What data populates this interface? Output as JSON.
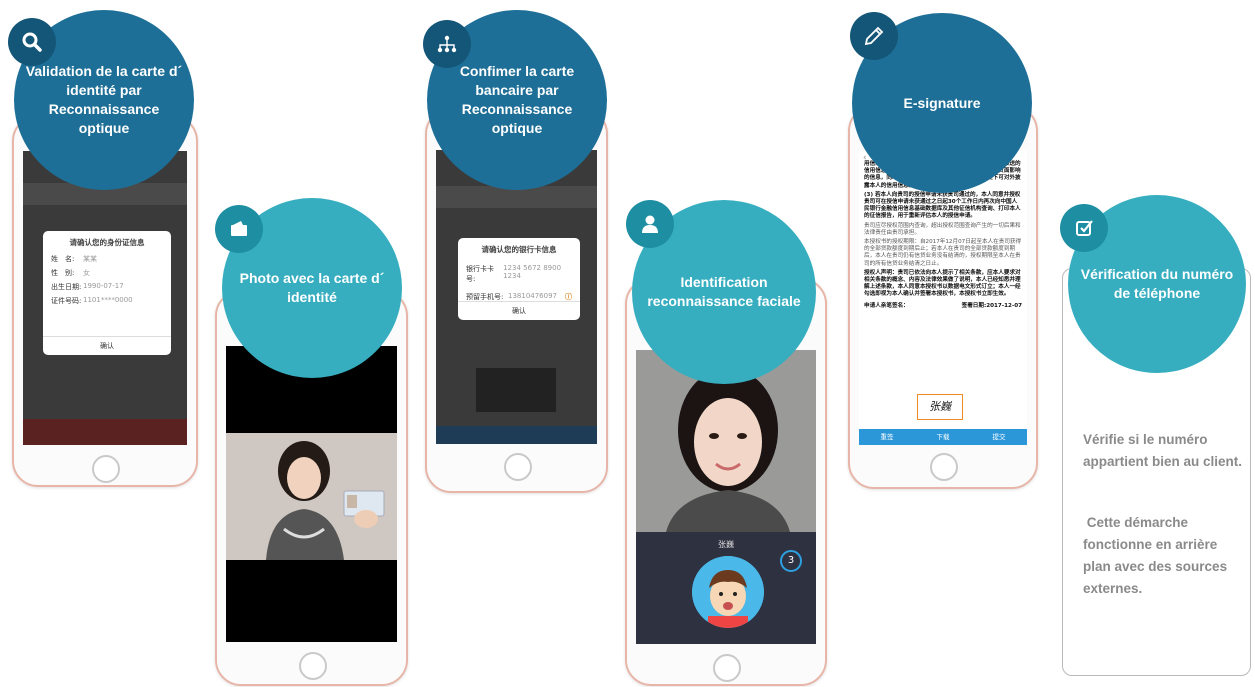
{
  "steps": [
    {
      "title": "Validation de la carte d´ identité par Reconnaissance optique",
      "badge_icon": "search-icon"
    },
    {
      "title": "Photo avec  la carte d´ identité",
      "badge_icon": "id-card-icon"
    },
    {
      "title": "Confimer la carte bancaire par Reconnaissance optique",
      "badge_icon": "network-icon"
    },
    {
      "title": "Identification reconnaissance faciale",
      "badge_icon": "user-icon"
    },
    {
      "title": "E-signature",
      "badge_icon": "pen-icon"
    },
    {
      "title": "Vérification du numéro de téléphone",
      "badge_icon": "checkbox-icon"
    }
  ],
  "id_dialog": {
    "title": "请确认您的身份证信息",
    "rows": [
      {
        "label": "姓　名:",
        "value": "某某"
      },
      {
        "label": "性　别:",
        "value": "女"
      },
      {
        "label": "出生日期:",
        "value": "1990-07-17"
      },
      {
        "label": "证件号码:",
        "value": "1101****0000"
      }
    ],
    "confirm": "确认"
  },
  "bank_dialog": {
    "title": "请确认您的银行卡信息",
    "rows": [
      {
        "label": "银行卡卡号:",
        "value": "1234 5672 8900 1234"
      },
      {
        "label": "预留手机号:",
        "value": "13810476097"
      }
    ],
    "confirm": "确认"
  },
  "face": {
    "name": "张巍",
    "countdown": "3"
  },
  "esign": {
    "paragraphs": [
      "用信息基础数据库及其他征信机构查询本人的信用信息，推送的信用信息包括但不限于借贷信息及对本人信用状况构成负面影响的信息，同时允许征信机构在不违反法律法规的前提下可对外披露本人的信用信息。",
      "(3) 若本人向贵司的授信申请未获贵司通过的，本人同意并授权贵司可在授信申请未获通过之日起30个工作日内再次向中国人民银行金融信用信息基础数据库及其他征信机构查询、打印本人的征信报告，用于重新评估本人的授信申请。",
      "贵司应尽授权范围内查询，超出授权范围查询产生的一切后果和法律责任由贵司承担。",
      "本授权书的授权期限：自2017年12月07日起至本人在贵司获得的全部贷款额度到期后止；若本人在贵司的全部贷款额度到期后，本人在贵司仍有信贷业务没有结清的，授权期限至本人在贵司的所有信贷业务结清之日止。",
      "授权人声明：贵司已依法向本人提示了相关条款，应本人要求对相关条款的概念、内容及法律效果做了说明，本人已经知悉并理解上述条款，本人同意本授权书以数据电文形式订立；本人一经勾选即视为本人确认并签署本授权书，本授权书立即生效。"
    ],
    "footer": "申请人亲笔签名：",
    "date": "签署日期:2017-12-07",
    "signature": "张巍",
    "buttons": [
      "重签",
      "下载",
      "提交"
    ]
  },
  "verification_text": [
    "Vérifie si le numéro appartient bien au client.",
    " Cette démarche fonctionne en arrière plan avec des sources externes."
  ]
}
